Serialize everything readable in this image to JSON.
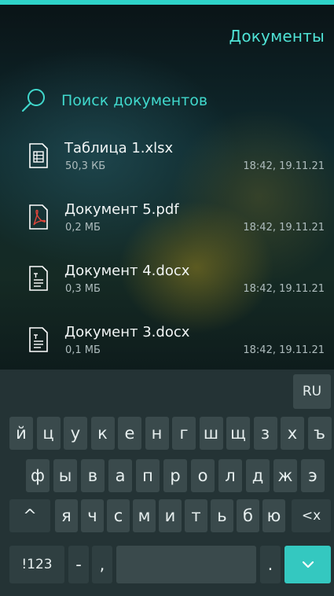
{
  "header": {
    "title": "Документы",
    "accent": "#2fd3c9"
  },
  "search": {
    "placeholder": "Поиск документов",
    "icon": "search-icon"
  },
  "files": [
    {
      "name": "Таблица 1.xlsx",
      "size": "50,3 КБ",
      "date": "18:42, 19.11.21",
      "icon": "spreadsheet-icon"
    },
    {
      "name": "Документ 5.pdf",
      "size": "0,2 МБ",
      "date": "18:42, 19.11.21",
      "icon": "pdf-icon"
    },
    {
      "name": "Документ 4.docx",
      "size": "0,3 МБ",
      "date": "18:42, 19.11.21",
      "icon": "text-document-icon"
    },
    {
      "name": "Документ 3.docx",
      "size": "0,1 МБ",
      "date": "18:42, 19.11.21",
      "icon": "text-document-icon"
    }
  ],
  "keyboard": {
    "lang": "RU",
    "row1": [
      "й",
      "ц",
      "у",
      "к",
      "е",
      "н",
      "г",
      "ш",
      "щ",
      "з",
      "х",
      "ъ"
    ],
    "row2": [
      "ф",
      "ы",
      "в",
      "а",
      "п",
      "р",
      "о",
      "л",
      "д",
      "ж",
      "э"
    ],
    "row3": [
      "я",
      "ч",
      "с",
      "м",
      "и",
      "т",
      "ь",
      "б",
      "ю"
    ],
    "shift": "^",
    "backspace": "<x",
    "symbols": "!123",
    "dash": "-",
    "comma": ",",
    "period": ".",
    "enter_icon": "chevron-down-icon"
  }
}
